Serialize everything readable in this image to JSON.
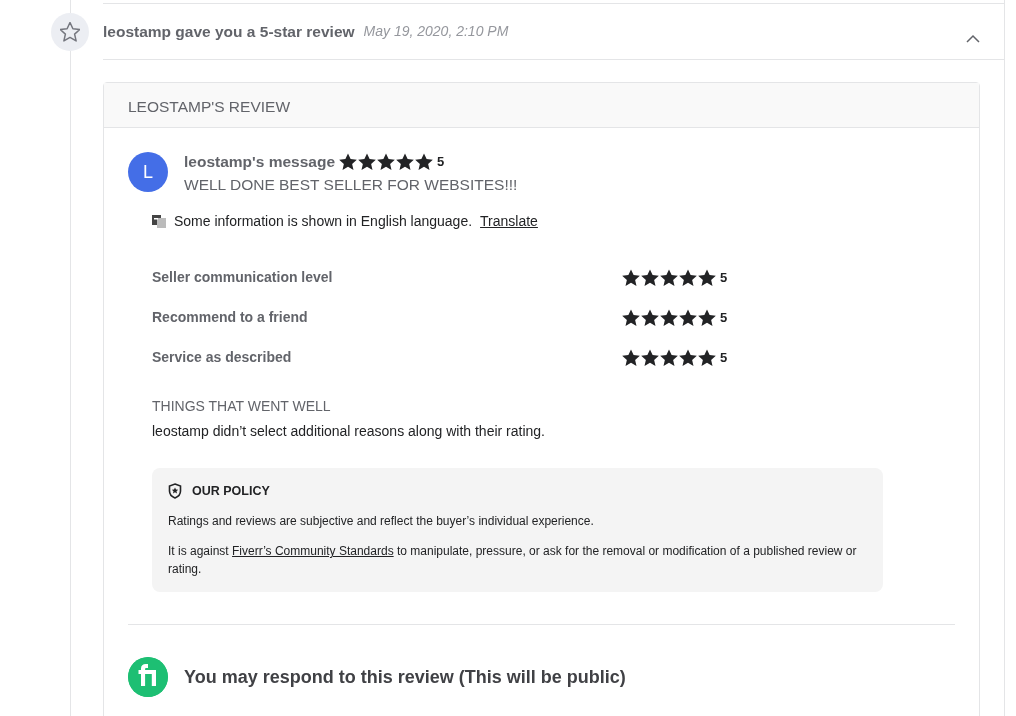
{
  "activity": {
    "title": "leostamp gave you a 5-star review",
    "date": "May 19, 2020, 2:10 PM",
    "expanded": true
  },
  "review": {
    "header": "LEOSTAMP'S REVIEW",
    "avatar_letter": "L",
    "author": "leostamp's message",
    "stars": 5,
    "score": "5",
    "message": "WELL DONE BEST SELLER FOR WEBSITES!!!",
    "translate_notice": "Some information is shown in English language.",
    "translate_link": "Translate",
    "ratings": [
      {
        "label": "Seller communication level",
        "stars": 5,
        "score": "5"
      },
      {
        "label": "Recommend to a friend",
        "stars": 5,
        "score": "5"
      },
      {
        "label": "Service as described",
        "stars": 5,
        "score": "5"
      }
    ],
    "went_well_title": "THINGS THAT WENT WELL",
    "went_well_text": "leostamp didn’t select additional reasons along with their rating.",
    "policy": {
      "title": "OUR POLICY",
      "text_1": "Ratings and reviews are subjective and reflect the buyer’s individual experience.",
      "text_2_before": "It is against",
      "text_2_link": "Fiverr’s Community Standards",
      "text_2_after": "to manipulate, pressure, or ask for the removal or modification of a published review or rating."
    },
    "respond_title": "You may respond to this review (This will be public)"
  }
}
